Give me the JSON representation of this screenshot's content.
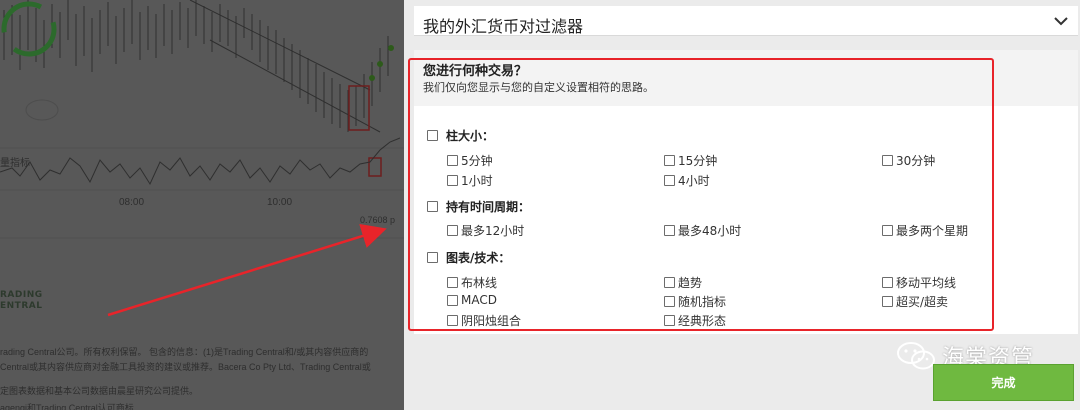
{
  "background": {
    "axis_labels": [
      "08:00",
      "10:00"
    ],
    "indicator_label": "量指标",
    "price_label": "0.7608 p",
    "logo_text": [
      "RADING",
      "ENTRAL"
    ],
    "disclaimer_lines": [
      "rading Central公司。所有权利保留。 包含的信息：(1)是Trading Central和/或其内容供应商的",
      "Central或其内容供应商对金融工具投资的建议或推荐。Bacera Co Pty Ltd、Trading Central或",
      "定图表数据和基本公司数据由晨星研究公司提供。",
      "agengi和Trading Central认可商标"
    ]
  },
  "filter": {
    "title": "我的外汇货币对过滤器",
    "question": "您进行何种交易？",
    "subtitle": "我们仅向您显示与您的自定义设置相符的思路。"
  },
  "sections": {
    "bar_size": {
      "label": "柱大小：",
      "options": [
        "5分钟",
        "15分钟",
        "30分钟",
        "1小时",
        "4小时"
      ]
    },
    "holding": {
      "label": "持有时间周期：",
      "options": [
        "最多12小时",
        "最多48小时",
        "最多两个星期"
      ]
    },
    "chart": {
      "label": "图表/技术：",
      "options": [
        "布林线",
        "趋势",
        "移动平均线",
        "MACD",
        "随机指标",
        "超买/超卖",
        "阴阳烛组合",
        "经典形态"
      ]
    }
  },
  "done_button": "完成",
  "watermark": "海棠资管",
  "colors": {
    "annotation_red": "#e8242a",
    "done_green": "#6fb940",
    "overlay_gray": "#585858"
  },
  "icons": {
    "dropdown": "chevron-down-icon",
    "watermark": "wechat-icon",
    "logo": "trading-central-logo"
  }
}
